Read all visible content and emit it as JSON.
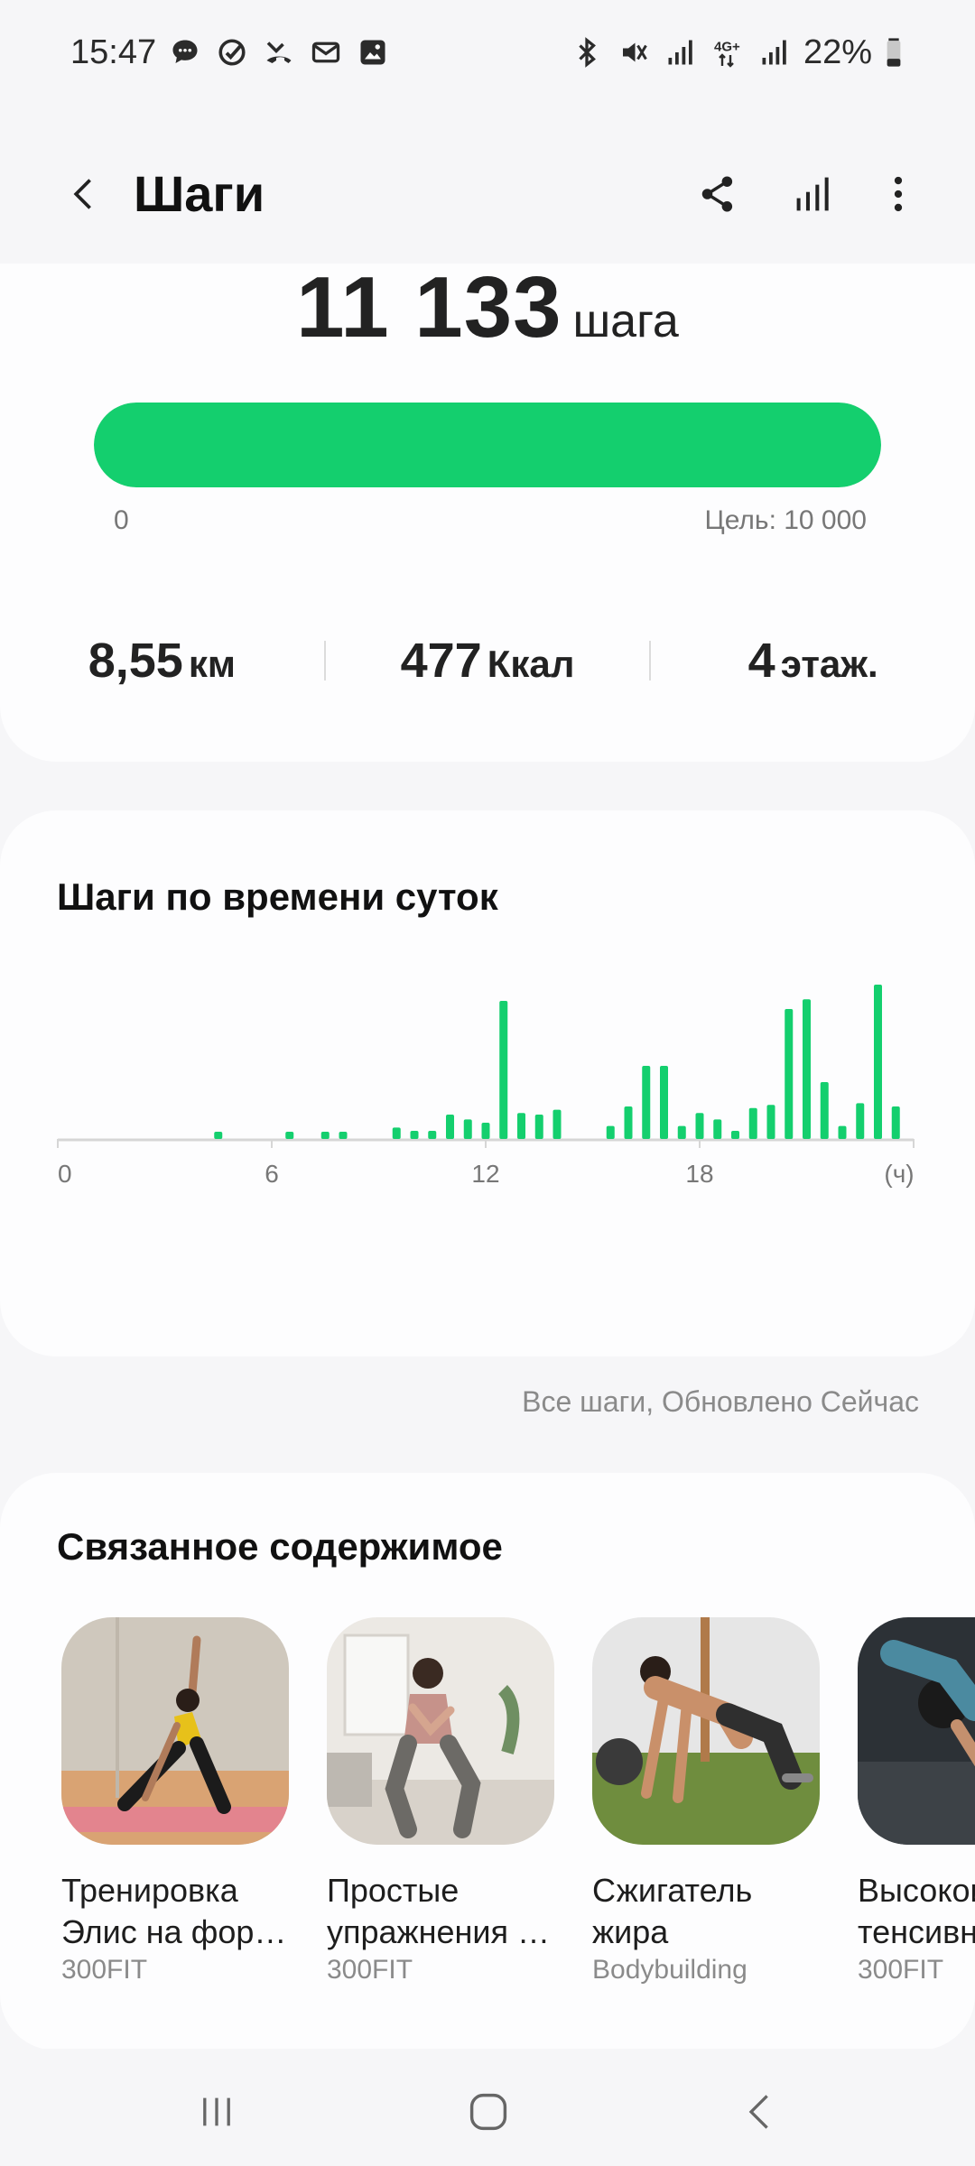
{
  "status_bar": {
    "time": "15:47",
    "left_icons": [
      "message-icon",
      "check-circle-icon",
      "missed-call-icon",
      "mail-icon",
      "gallery-icon"
    ],
    "right_icons": [
      "bluetooth-icon",
      "mute-icon",
      "signal-icon",
      "4g-data-icon",
      "signal-icon"
    ],
    "network": "4G+",
    "battery": "22%"
  },
  "app_bar": {
    "title": "Шаги",
    "actions": [
      "share-icon",
      "chart-icon",
      "more-icon"
    ]
  },
  "summary": {
    "steps_value": "11 133",
    "steps_unit": "шага",
    "progress_fraction": 1.0,
    "progress_min": "0",
    "progress_goal": "Цель: 10 000",
    "accent_color": "#14cf6e",
    "metrics": [
      {
        "value": "8,55",
        "unit": "км"
      },
      {
        "value": "477",
        "unit": "Ккал"
      },
      {
        "value": "4",
        "unit": "этаж."
      }
    ]
  },
  "hourly": {
    "title": "Шаги по времени суток",
    "update_note": "Все шаги, Обновлено Сейчас"
  },
  "chart_data": {
    "type": "bar",
    "x_ticks": [
      "0",
      "6",
      "12",
      "18",
      "(ч)"
    ],
    "x_range": [
      0,
      24
    ],
    "bar_color": "#14cf6e",
    "bars": [
      {
        "x": 4.5,
        "value": 4
      },
      {
        "x": 6.5,
        "value": 4
      },
      {
        "x": 7.5,
        "value": 4
      },
      {
        "x": 8.0,
        "value": 4
      },
      {
        "x": 9.5,
        "value": 7
      },
      {
        "x": 10.0,
        "value": 5
      },
      {
        "x": 10.5,
        "value": 5
      },
      {
        "x": 11.0,
        "value": 15
      },
      {
        "x": 11.5,
        "value": 12
      },
      {
        "x": 12.0,
        "value": 10
      },
      {
        "x": 12.5,
        "value": 85
      },
      {
        "x": 13.0,
        "value": 16
      },
      {
        "x": 13.5,
        "value": 15
      },
      {
        "x": 14.0,
        "value": 18
      },
      {
        "x": 15.5,
        "value": 8
      },
      {
        "x": 16.0,
        "value": 20
      },
      {
        "x": 16.5,
        "value": 45
      },
      {
        "x": 17.0,
        "value": 45
      },
      {
        "x": 17.5,
        "value": 8
      },
      {
        "x": 18.0,
        "value": 16
      },
      {
        "x": 18.5,
        "value": 12
      },
      {
        "x": 19.0,
        "value": 5
      },
      {
        "x": 19.5,
        "value": 19
      },
      {
        "x": 20.0,
        "value": 21
      },
      {
        "x": 20.5,
        "value": 80
      },
      {
        "x": 21.0,
        "value": 86
      },
      {
        "x": 21.5,
        "value": 35
      },
      {
        "x": 22.0,
        "value": 8
      },
      {
        "x": 22.5,
        "value": 22
      },
      {
        "x": 23.0,
        "value": 95
      },
      {
        "x": 23.5,
        "value": 20
      }
    ]
  },
  "related": {
    "title": "Связанное содержимое",
    "items": [
      {
        "title_line1": "Тренировка",
        "title_line2": "Элис на фор…",
        "source": "300FIT"
      },
      {
        "title_line1": "Простые",
        "title_line2": "упражнения …",
        "source": "300FIT"
      },
      {
        "title_line1": "Сжигатель",
        "title_line2": "жира",
        "source": "Bodybuilding"
      },
      {
        "title_line1": "Высокоин",
        "title_line2": "тенсивн",
        "source": "300FIT"
      }
    ]
  },
  "nav_bar": {
    "buttons": [
      "recents-icon",
      "home-icon",
      "back-icon"
    ]
  }
}
